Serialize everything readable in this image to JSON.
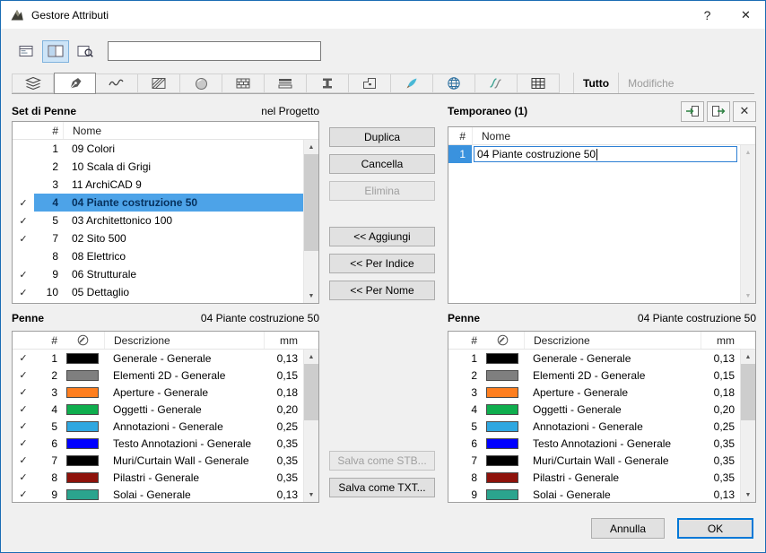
{
  "window": {
    "title": "Gestore Attributi"
  },
  "icons": {
    "checkmark": "✓",
    "help": "?",
    "close": "✕",
    "scroll_up": "▲",
    "scroll_down": "▼"
  },
  "topbar": {
    "field_value": "",
    "buttons": [
      {
        "name": "panel-view-single",
        "pressed": false
      },
      {
        "name": "panel-view-dual",
        "pressed": true
      },
      {
        "name": "panel-view-search",
        "pressed": false
      }
    ]
  },
  "tabbar": {
    "tab_names": [
      "layers",
      "pens",
      "line-types",
      "fills",
      "surfaces",
      "building-materials",
      "composites",
      "profiles",
      "zone-categories",
      "markers",
      "cities",
      "operation-profiles",
      "schedules"
    ],
    "selected_index": 1,
    "tutto_label": "Tutto",
    "modifiche_label": "Modifiche"
  },
  "pen_sets": {
    "title": "Set di Penne",
    "scope_label": "nel Progetto",
    "columns": {
      "index": "#",
      "name": "Nome"
    },
    "rows": [
      {
        "checked": false,
        "index": "1",
        "name": "09 Colori",
        "selected": false
      },
      {
        "checked": false,
        "index": "2",
        "name": "10 Scala di Grigi",
        "selected": false
      },
      {
        "checked": false,
        "index": "3",
        "name": "11 ArchiCAD 9",
        "selected": false
      },
      {
        "checked": true,
        "index": "4",
        "name": "04 Piante costruzione 50",
        "selected": true
      },
      {
        "checked": true,
        "index": "5",
        "name": "03 Architettonico 100",
        "selected": false
      },
      {
        "checked": true,
        "index": "7",
        "name": "02 Sito 500",
        "selected": false
      },
      {
        "checked": false,
        "index": "8",
        "name": "08 Elettrico",
        "selected": false
      },
      {
        "checked": true,
        "index": "9",
        "name": "06 Strutturale",
        "selected": false
      },
      {
        "checked": true,
        "index": "10",
        "name": "05 Dettaglio",
        "selected": false
      }
    ]
  },
  "actions": {
    "group1": [
      {
        "name": "duplicate",
        "label": "Duplica",
        "disabled": false
      },
      {
        "name": "cancel-item",
        "label": "Cancella",
        "disabled": false
      },
      {
        "name": "delete",
        "label": "Elimina",
        "disabled": true
      }
    ],
    "group2": [
      {
        "name": "append",
        "label": "<< Aggiungi",
        "disabled": false
      },
      {
        "name": "by-index",
        "label": "<< Per Indice",
        "disabled": false
      },
      {
        "name": "by-name",
        "label": "<< Per Nome",
        "disabled": false
      }
    ],
    "group3": [
      {
        "name": "save-stb",
        "label": "Salva come STB...",
        "disabled": true
      },
      {
        "name": "save-txt",
        "label": "Salva come TXT...",
        "disabled": false
      }
    ]
  },
  "temporary": {
    "title": "Temporaneo (1)",
    "columns": {
      "index": "#",
      "name": "Nome"
    },
    "rows": [
      {
        "index": "1",
        "name_value": "04 Piante costruzione 50",
        "editing": true
      }
    ]
  },
  "pens_left": {
    "title": "Penne",
    "subtitle": "04 Piante costruzione 50",
    "columns": {
      "index": "#",
      "desc": "Descrizione",
      "mm": "mm"
    },
    "rows": [
      {
        "checked": true,
        "index": "1",
        "color": "#000000",
        "desc": "Generale - Generale",
        "mm": "0,13"
      },
      {
        "checked": true,
        "index": "2",
        "color": "#7f7f7f",
        "desc": "Elementi 2D - Generale",
        "mm": "0,15"
      },
      {
        "checked": true,
        "index": "3",
        "color": "#ff7f1f",
        "desc": "Aperture - Generale",
        "mm": "0,18"
      },
      {
        "checked": true,
        "index": "4",
        "color": "#0fae4e",
        "desc": "Oggetti - Generale",
        "mm": "0,20"
      },
      {
        "checked": true,
        "index": "5",
        "color": "#2fa7e0",
        "desc": "Annotazioni - Generale",
        "mm": "0,25"
      },
      {
        "checked": true,
        "index": "6",
        "color": "#0000ff",
        "desc": "Testo Annotazioni - Generale",
        "mm": "0,35"
      },
      {
        "checked": true,
        "index": "7",
        "color": "#000000",
        "desc": "Muri/Curtain Wall - Generale",
        "mm": "0,35"
      },
      {
        "checked": true,
        "index": "8",
        "color": "#8e120b",
        "desc": "Pilastri - Generale",
        "mm": "0,35"
      },
      {
        "checked": true,
        "index": "9",
        "color": "#2ba48e",
        "desc": "Solai - Generale",
        "mm": "0,13"
      }
    ]
  },
  "pens_right": {
    "title": "Penne",
    "subtitle": "04 Piante costruzione 50",
    "columns": {
      "index": "#",
      "desc": "Descrizione",
      "mm": "mm"
    },
    "rows": [
      {
        "checked": false,
        "index": "1",
        "color": "#000000",
        "desc": "Generale - Generale",
        "mm": "0,13"
      },
      {
        "checked": false,
        "index": "2",
        "color": "#7f7f7f",
        "desc": "Elementi 2D - Generale",
        "mm": "0,15"
      },
      {
        "checked": false,
        "index": "3",
        "color": "#ff7f1f",
        "desc": "Aperture - Generale",
        "mm": "0,18"
      },
      {
        "checked": false,
        "index": "4",
        "color": "#0fae4e",
        "desc": "Oggetti - Generale",
        "mm": "0,20"
      },
      {
        "checked": false,
        "index": "5",
        "color": "#2fa7e0",
        "desc": "Annotazioni - Generale",
        "mm": "0,25"
      },
      {
        "checked": false,
        "index": "6",
        "color": "#0000ff",
        "desc": "Testo Annotazioni - Generale",
        "mm": "0,35"
      },
      {
        "checked": false,
        "index": "7",
        "color": "#000000",
        "desc": "Muri/Curtain Wall - Generale",
        "mm": "0,35"
      },
      {
        "checked": false,
        "index": "8",
        "color": "#8e120b",
        "desc": "Pilastri - Generale",
        "mm": "0,35"
      },
      {
        "checked": false,
        "index": "9",
        "color": "#2ba48e",
        "desc": "Solai - Generale",
        "mm": "0,13"
      }
    ]
  },
  "footer": {
    "cancel_label": "Annulla",
    "ok_label": "OK"
  }
}
